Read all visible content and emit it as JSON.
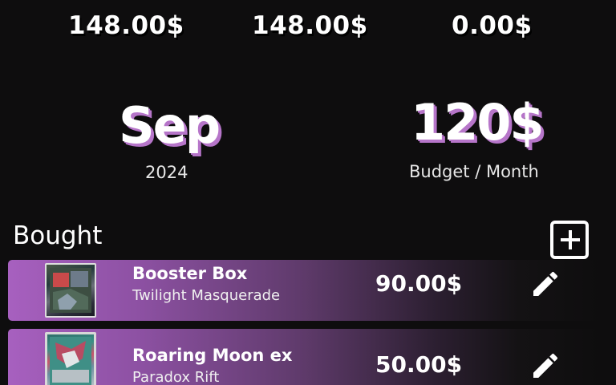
{
  "summary": {
    "left_amount": "148.00$",
    "middle_amount": "148.00$",
    "right_amount": "0.00$"
  },
  "period": {
    "month": "Sep",
    "year": "2024"
  },
  "budget": {
    "value": "120$",
    "label": "Budget / Month"
  },
  "bought": {
    "title": "Bought",
    "items": [
      {
        "name": "Booster Box",
        "set": "Twilight Masquerade",
        "price": "90.00$",
        "thumbnail": "booster-box-image"
      },
      {
        "name": "Roaring Moon ex",
        "set": "Paradox Rift",
        "price": "50.00$",
        "thumbnail": "card-image"
      }
    ]
  },
  "icons": {
    "add": "plus-square-icon",
    "edit": "pencil-icon"
  },
  "colors": {
    "background": "#0e0d0e",
    "accent": "#b675c9",
    "row_gradient_start": "#a760bf"
  }
}
